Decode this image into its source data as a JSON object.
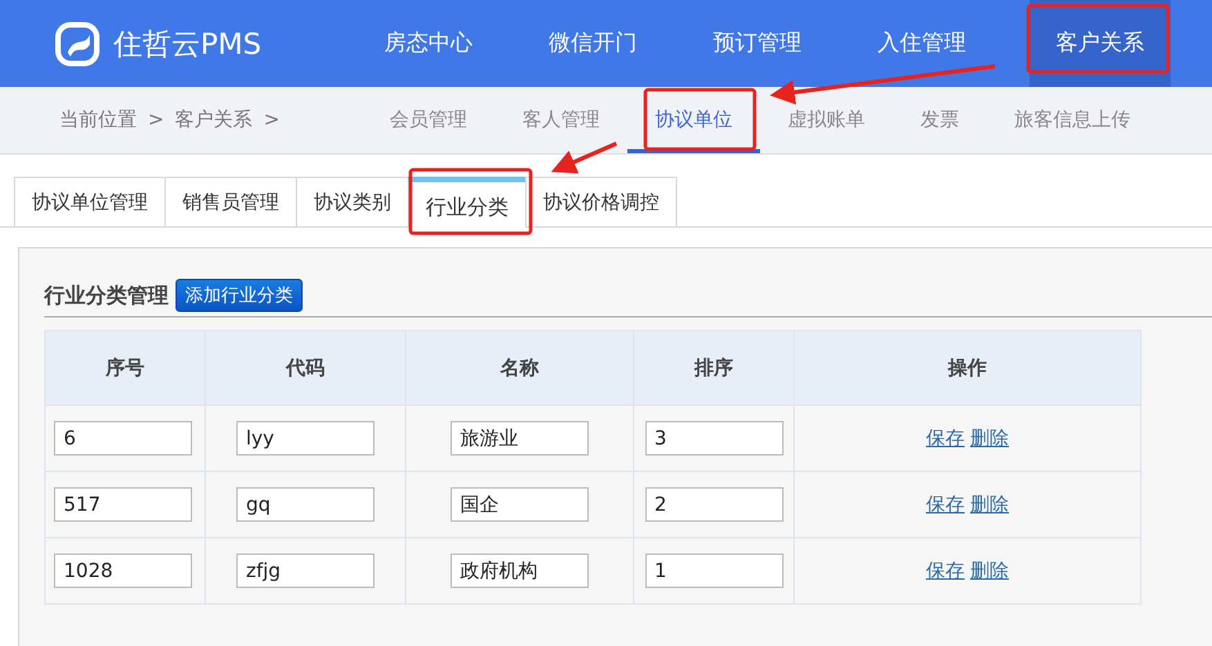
{
  "brand": {
    "name": "住哲云PMS"
  },
  "main_nav": [
    {
      "label": "房态中心",
      "selected": false
    },
    {
      "label": "微信开门",
      "selected": false
    },
    {
      "label": "预订管理",
      "selected": false
    },
    {
      "label": "入住管理",
      "selected": false
    },
    {
      "label": "客户关系",
      "selected": true
    }
  ],
  "breadcrumb": [
    "当前位置",
    ">",
    "客户关系",
    ">"
  ],
  "sub_nav": [
    {
      "label": "会员管理",
      "selected": false
    },
    {
      "label": "客人管理",
      "selected": false
    },
    {
      "label": "协议单位",
      "selected": true
    },
    {
      "label": "虚拟账单",
      "selected": false
    },
    {
      "label": "发票",
      "selected": false
    },
    {
      "label": "旅客信息上传",
      "selected": false
    }
  ],
  "tabs": [
    {
      "label": "协议单位管理",
      "selected": false
    },
    {
      "label": "销售员管理",
      "selected": false
    },
    {
      "label": "协议类别",
      "selected": false
    },
    {
      "label": "行业分类",
      "selected": true
    },
    {
      "label": "协议价格调控",
      "selected": false
    }
  ],
  "panel": {
    "title": "行业分类管理",
    "add_button": "添加行业分类"
  },
  "table": {
    "columns": [
      "序号",
      "代码",
      "名称",
      "排序",
      "操作"
    ],
    "rows": [
      {
        "serial": "6",
        "code": "lyy",
        "name": "旅游业",
        "order": "3",
        "actions": [
          "保存",
          "删除"
        ]
      },
      {
        "serial": "517",
        "code": "gq",
        "name": "国企",
        "order": "2",
        "actions": [
          "保存",
          "删除"
        ]
      },
      {
        "serial": "1028",
        "code": "zfjg",
        "name": "政府机构",
        "order": "1",
        "actions": [
          "保存",
          "删除"
        ]
      }
    ]
  }
}
